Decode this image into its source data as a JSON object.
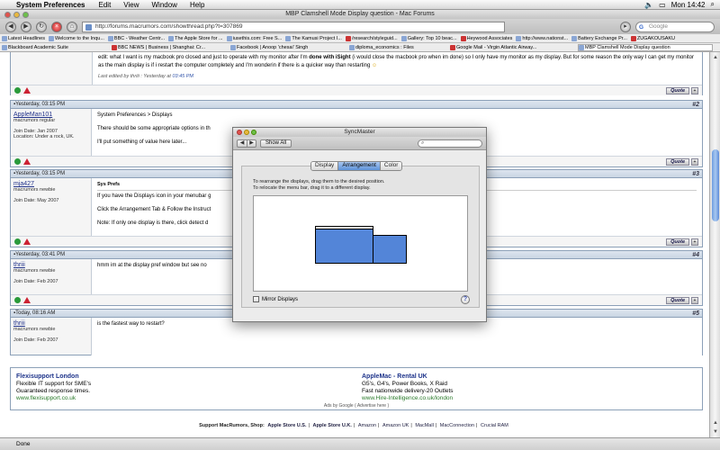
{
  "menubar": {
    "app": "System Preferences",
    "items": [
      "Edit",
      "View",
      "Window",
      "Help"
    ],
    "clock": "Mon 14:42"
  },
  "browser": {
    "window_title": "MBP Clamshell Mode Display question - Mac Forums",
    "url": "http://forums.macrumors.com/showthread.php?t=307869",
    "search_placeholder": "Google",
    "status": "Done"
  },
  "bookmarks": [
    "Latest Headlines",
    "Welcome to the Inqu...",
    "BBC - Weather Centr...",
    "The Apple Store for ...",
    "iusethis.com: Free S...",
    "The Kamusi Project I...",
    "/research/styleguid...",
    "Gallery: Top 10 beac...",
    "Heywood Associates",
    "http://www.nationst...",
    "Battery Exchange Pr...",
    "ZUGAKOUSAKU"
  ],
  "bookmarks2": [
    "Blackboard Academic Suite",
    "BBC NEWS | Business | Shanghai: Cr...",
    "Facebook | Anoop 'chesai' Singh",
    "diploma_economics : Files",
    "Google Mail - Virgin Atlantic Airway...",
    "MBP Clamshell Mode Display question"
  ],
  "thread": {
    "top_post": {
      "text_before": "edit: what I want is my macbook pro closed and just to operate with my monitor after I'm ",
      "bold1": "done with iSight",
      "text_mid": " (i would close the macbook pro when im done) so I only have my monitor as my display. But for some reason the only way I can get my monitor as the main display is if i restart the computer completely and I'm wonderin if there is a quicker way than restarting ",
      "edited": "Last edited by thriii : Yesterday at ",
      "edited_time": "03:45 PM"
    },
    "posts": [
      {
        "date": "Yesterday, 03:15 PM",
        "num": "#2",
        "author": "AppleMan101",
        "title": "macrumors regular",
        "joined": "Join Date: Jan 2007",
        "location": "Location: Under a rock, UK.",
        "lines": [
          "System Preferences > Displays",
          "",
          "There should be some appropriate options in th",
          "",
          "I'll put something of value here later..."
        ]
      },
      {
        "date": "Yesterday, 03:15 PM",
        "num": "#3",
        "author": "mja427",
        "title": "macrumors newbie",
        "joined": "Join Date: May 2007",
        "location": "",
        "subject": "Sys Prefs",
        "lines": [
          "If you have the Displays icon in your menubar g",
          "",
          "Click the Arrangement Tab & Follow the Instruct",
          "",
          "Note: If only one display is there, click detect d"
        ]
      },
      {
        "date": "Yesterday, 03:41 PM",
        "num": "#4",
        "author": "thriii",
        "title": "macrumors newbie",
        "joined": "Join Date: Feb 2007",
        "location": "",
        "lines": [
          "hmm im at the display pref window but see no"
        ]
      },
      {
        "date": "Today, 08:16 AM",
        "num": "#5",
        "author": "thriii",
        "title": "macrumors newbie",
        "joined": "Join Date: Feb 2007",
        "location": "",
        "lines": [
          "is the fastest way to restart?"
        ]
      }
    ],
    "quote_label": "Quote"
  },
  "ads": {
    "left": {
      "title": "Flexisupport London",
      "line1": "Flexible IT support for SME's",
      "line2": "Guaranteed response times.",
      "url": "www.flexisupport.co.uk"
    },
    "right": {
      "title": "AppleMac - Rental UK",
      "line1": "G5's, G4's, Power Books, X Raid",
      "line2": "Fast nationwide delivery-20 Outlets",
      "url": "www.Hire-Intelligence.co.uk/london"
    },
    "adsby": "Ads by Google ( Advertise here )"
  },
  "footer": {
    "lead": "Support MacRumors, Shop:",
    "links": [
      "Apple Store U.S.",
      "Apple Store U.K.",
      "Amazon",
      "Amazon UK",
      "MacMall",
      "MacConnection",
      "Crucial RAM"
    ]
  },
  "dialog": {
    "title": "SyncMaster",
    "show_all": "Show All",
    "tabs": [
      "Display",
      "Arrangement",
      "Color"
    ],
    "selected_tab": "Arrangement",
    "instr1": "To rearrange the displays, drag them to the desired position.",
    "instr2": "To relocate the menu bar, drag it to a different display.",
    "mirror": "Mirror Displays",
    "help": "?"
  },
  "colors": {
    "display_blue": "#5385d8",
    "link": "#22338a",
    "selected_tab": "#5d92d9"
  }
}
